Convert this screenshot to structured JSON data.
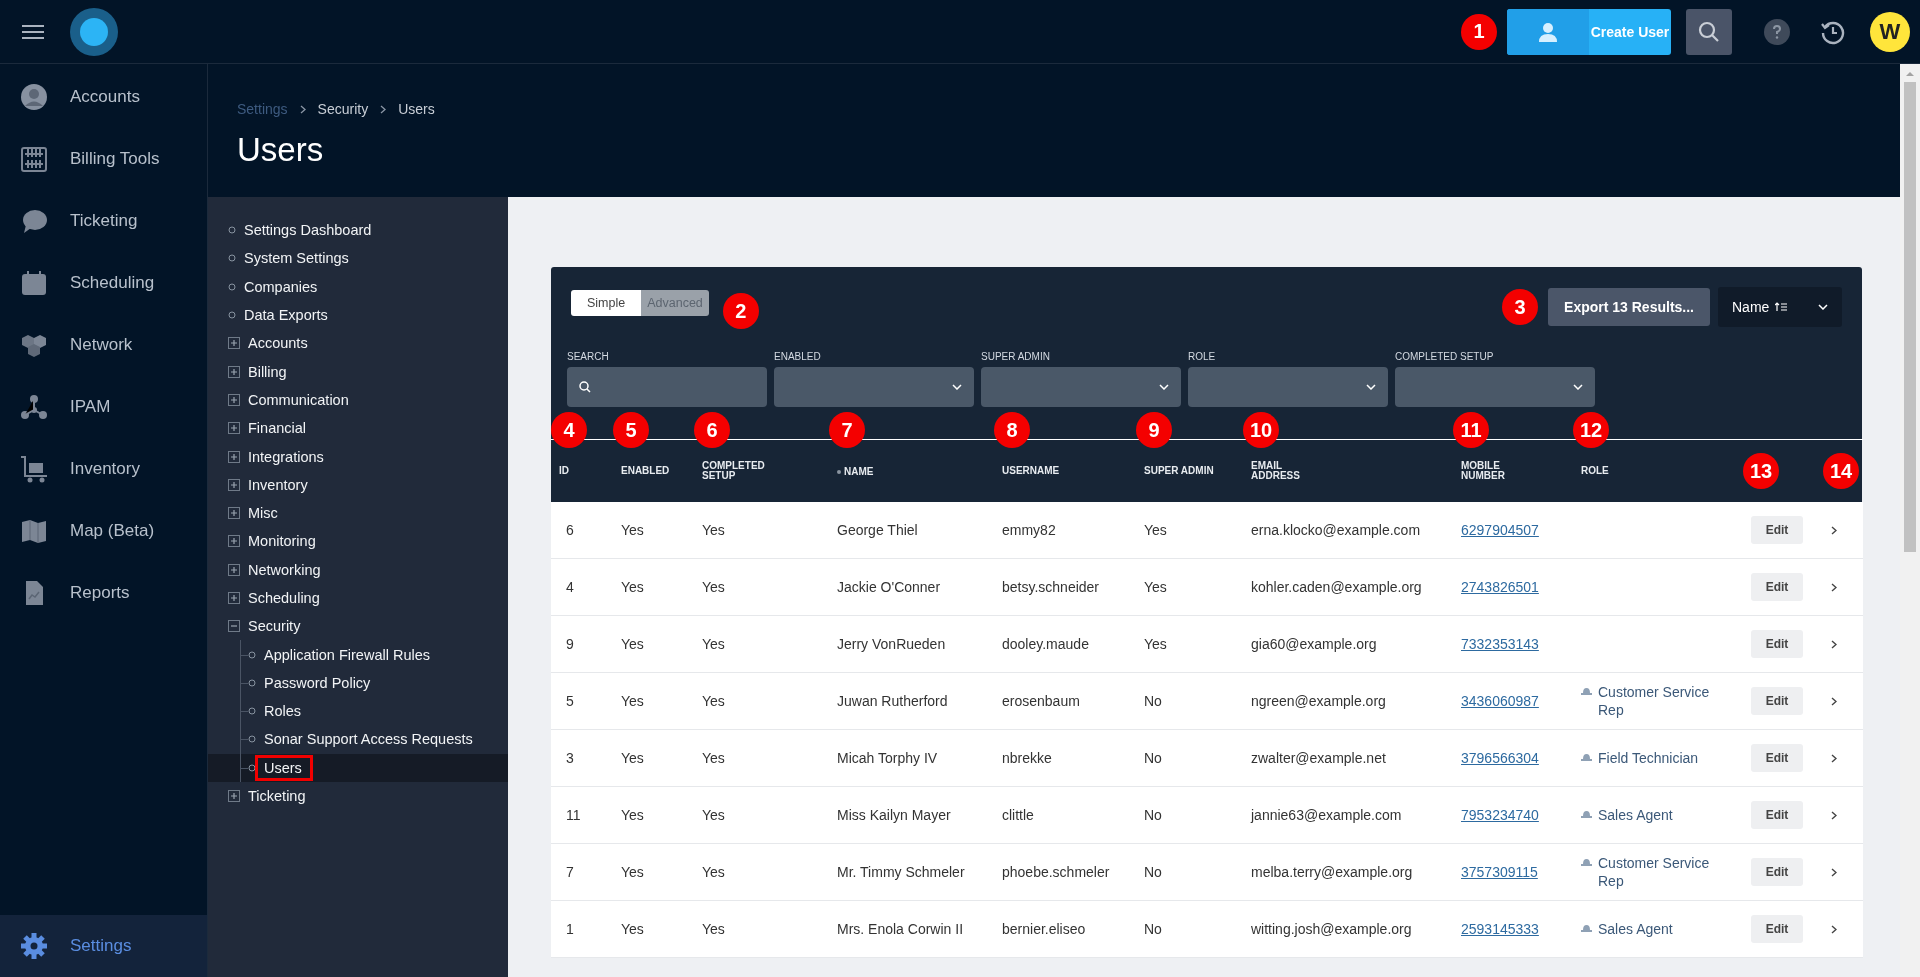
{
  "topbar": {
    "create_marker": "1",
    "create_button": "Create User",
    "avatar": "W"
  },
  "left_nav": [
    {
      "label": "Accounts",
      "selected": false
    },
    {
      "label": "Billing Tools",
      "selected": false
    },
    {
      "label": "Ticketing",
      "selected": false
    },
    {
      "label": "Scheduling",
      "selected": false
    },
    {
      "label": "Network",
      "selected": false
    },
    {
      "label": "IPAM",
      "selected": false
    },
    {
      "label": "Inventory",
      "selected": false
    },
    {
      "label": "Map (Beta)",
      "selected": false
    },
    {
      "label": "Reports",
      "selected": false
    }
  ],
  "left_nav_bottom": {
    "label": "Settings",
    "selected": true
  },
  "breadcrumb": [
    {
      "label": "Settings",
      "link": true
    },
    {
      "label": "Security",
      "link": false
    },
    {
      "label": "Users",
      "link": false
    }
  ],
  "page_title": "Users",
  "settings_nav": [
    {
      "kind": "link",
      "label": "Settings Dashboard",
      "selected": false
    },
    {
      "kind": "link",
      "label": "System Settings",
      "selected": false
    },
    {
      "kind": "link",
      "label": "Companies",
      "selected": false
    },
    {
      "kind": "link",
      "label": "Data Exports",
      "selected": false
    },
    {
      "kind": "group",
      "label": "Accounts",
      "expanded": false,
      "selected": false
    },
    {
      "kind": "group",
      "label": "Billing",
      "expanded": false,
      "selected": false
    },
    {
      "kind": "group",
      "label": "Communication",
      "expanded": false,
      "selected": false
    },
    {
      "kind": "group",
      "label": "Financial",
      "expanded": false,
      "selected": false
    },
    {
      "kind": "group",
      "label": "Integrations",
      "expanded": false,
      "selected": false
    },
    {
      "kind": "group",
      "label": "Inventory",
      "expanded": false,
      "selected": false
    },
    {
      "kind": "group",
      "label": "Misc",
      "expanded": false,
      "selected": false
    },
    {
      "kind": "group",
      "label": "Monitoring",
      "expanded": false,
      "selected": false
    },
    {
      "kind": "group",
      "label": "Networking",
      "expanded": false,
      "selected": false
    },
    {
      "kind": "group",
      "label": "Scheduling",
      "expanded": false,
      "selected": false
    },
    {
      "kind": "group",
      "label": "Security",
      "expanded": true,
      "selected": false,
      "children": [
        {
          "kind": "link",
          "label": "Application Firewall Rules",
          "selected": false
        },
        {
          "kind": "link",
          "label": "Password Policy",
          "selected": false
        },
        {
          "kind": "link",
          "label": "Roles",
          "selected": false
        },
        {
          "kind": "link",
          "label": "Sonar Support Access Requests",
          "selected": false
        },
        {
          "kind": "link",
          "label": "Users",
          "selected": true,
          "highlighted": true
        }
      ]
    },
    {
      "kind": "group",
      "label": "Ticketing",
      "expanded": false,
      "selected": false
    }
  ],
  "toolbar": {
    "modes": [
      {
        "label": "Simple",
        "selected": true
      },
      {
        "label": "Advanced",
        "selected": false
      }
    ],
    "mode_marker": "2",
    "export_marker": "3",
    "export_button": "Export 13 Results...",
    "sort": "Name"
  },
  "filters": [
    {
      "label": "SEARCH",
      "kind": "search"
    },
    {
      "label": "ENABLED",
      "kind": "select"
    },
    {
      "label": "SUPER ADMIN",
      "kind": "select"
    },
    {
      "label": "ROLE",
      "kind": "select"
    },
    {
      "label": "COMPLETED SETUP",
      "kind": "select"
    }
  ],
  "table": {
    "columns": [
      {
        "label": "ID",
        "marker": "4"
      },
      {
        "label": "ENABLED",
        "marker": "5"
      },
      {
        "label": "COMPLETED SETUP",
        "marker": "6"
      },
      {
        "label": "NAME",
        "marker": "7",
        "sorted": true
      },
      {
        "label": "USERNAME",
        "marker": "8"
      },
      {
        "label": "SUPER ADMIN",
        "marker": "9"
      },
      {
        "label": "EMAIL ADDRESS",
        "marker": "10"
      },
      {
        "label": "MOBILE NUMBER",
        "marker": "11"
      },
      {
        "label": "ROLE",
        "marker": "12"
      },
      {
        "marker": "13"
      },
      {
        "marker": "14"
      }
    ],
    "rows": [
      {
        "id": "6",
        "enabled": "Yes",
        "completed_setup": "Yes",
        "name": "George Thiel",
        "username": "emmy82",
        "super_admin": "Yes",
        "email": "erna.klocko@example.com",
        "mobile": "6297904507",
        "action": "Edit"
      },
      {
        "id": "4",
        "enabled": "Yes",
        "completed_setup": "Yes",
        "name": "Jackie O'Conner",
        "username": "betsy.schneider",
        "super_admin": "Yes",
        "email": "kohler.caden@example.org",
        "mobile": "2743826501",
        "action": "Edit"
      },
      {
        "id": "9",
        "enabled": "Yes",
        "completed_setup": "Yes",
        "name": "Jerry VonRueden",
        "username": "dooley.maude",
        "super_admin": "Yes",
        "email": "gia60@example.org",
        "mobile": "7332353143",
        "action": "Edit"
      },
      {
        "id": "5",
        "enabled": "Yes",
        "completed_setup": "Yes",
        "name": "Juwan Rutherford",
        "username": "erosenbaum",
        "super_admin": "No",
        "email": "ngreen@example.org",
        "mobile": "3436060987",
        "role": "Customer Service Rep",
        "action": "Edit"
      },
      {
        "id": "3",
        "enabled": "Yes",
        "completed_setup": "Yes",
        "name": "Micah Torphy IV",
        "username": "nbrekke",
        "super_admin": "No",
        "email": "zwalter@example.net",
        "mobile": "3796566304",
        "role": "Field Technician",
        "action": "Edit"
      },
      {
        "id": "11",
        "enabled": "Yes",
        "completed_setup": "Yes",
        "name": "Miss Kailyn Mayer",
        "username": "clittle",
        "super_admin": "No",
        "email": "jannie63@example.com",
        "mobile": "7953234740",
        "role": "Sales Agent",
        "action": "Edit"
      },
      {
        "id": "7",
        "enabled": "Yes",
        "completed_setup": "Yes",
        "name": "Mr. Timmy Schmeler",
        "username": "phoebe.schmeler",
        "super_admin": "No",
        "email": "melba.terry@example.org",
        "mobile": "3757309115",
        "role": "Customer Service Rep",
        "action": "Edit"
      },
      {
        "id": "1",
        "enabled": "Yes",
        "completed_setup": "Yes",
        "name": "Mrs. Enola Corwin II",
        "username": "bernier.eliseo",
        "super_admin": "No",
        "email": "witting.josh@example.org",
        "mobile": "2593145333",
        "role": "Sales Agent",
        "action": "Edit"
      }
    ]
  }
}
